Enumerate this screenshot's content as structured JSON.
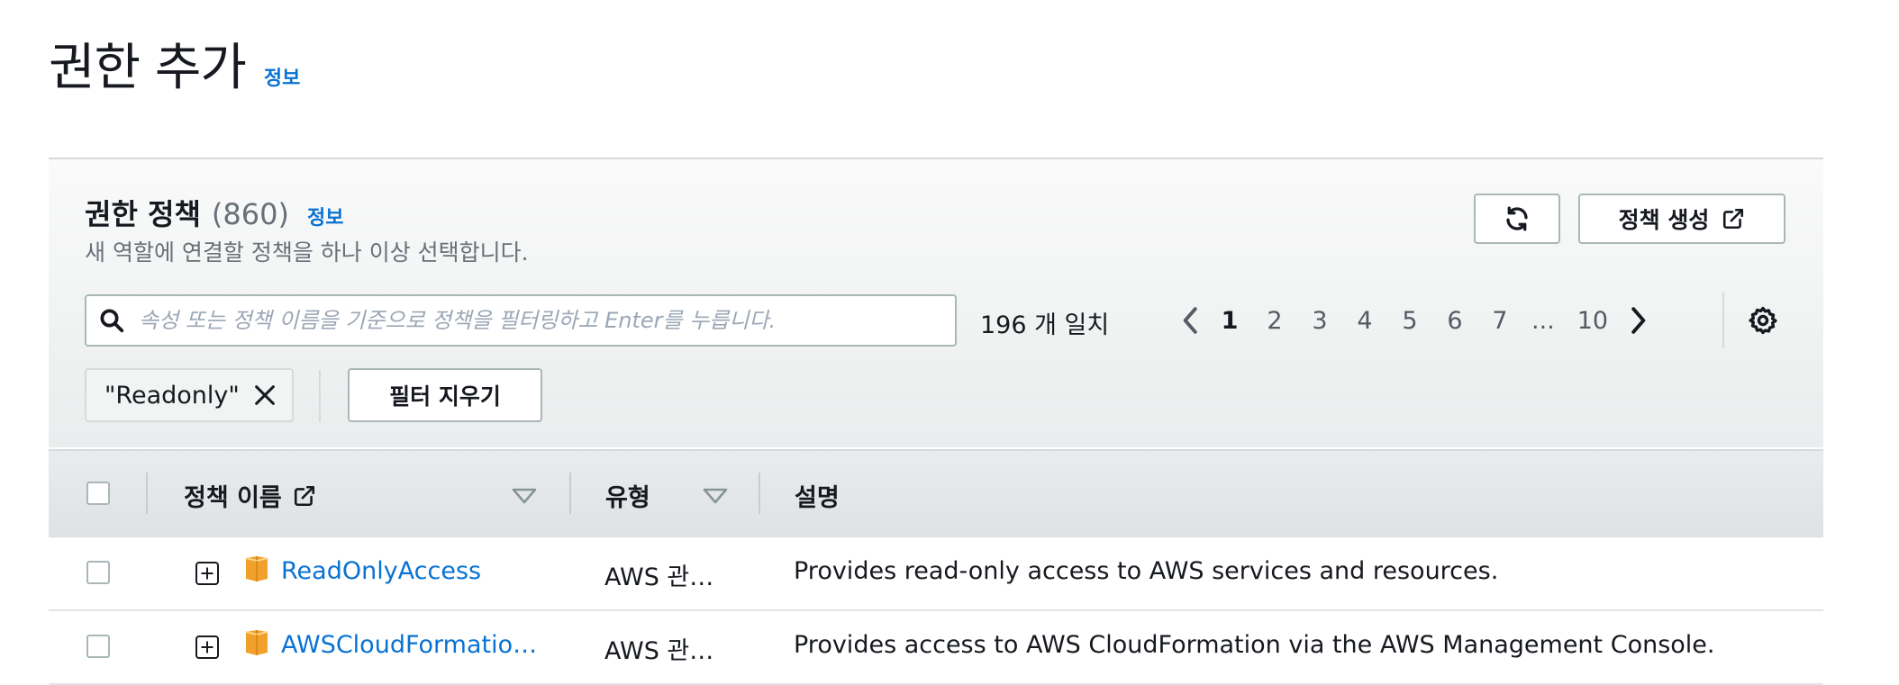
{
  "page": {
    "title": "권한 추가",
    "info_label": "정보"
  },
  "policies_panel": {
    "title": "권한 정책",
    "count": "(860)",
    "info_label": "정보",
    "description": "새 역할에 연결할 정책을 하나 이상 선택합니다.",
    "refresh_icon": "refresh-icon",
    "create_policy_label": "정책 생성",
    "create_policy_icon": "external-link-icon"
  },
  "filter": {
    "placeholder": "속성 또는 정책 이름을 기준으로 정책을 필터링하고 Enter를 누릅니다.",
    "value": "",
    "match_count": "196 개 일치",
    "token_label": "\"Readonly\"",
    "clear_label": "필터 지우기"
  },
  "pagination": {
    "prev_icon": "chevron-left-icon",
    "next_icon": "chevron-right-icon",
    "pages": [
      "1",
      "2",
      "3",
      "4",
      "5",
      "6",
      "7"
    ],
    "current": "1",
    "ellipsis": "...",
    "last": "10",
    "settings_icon": "gear-icon"
  },
  "table": {
    "columns": {
      "name": "정책 이름",
      "type": "유형",
      "description": "설명"
    },
    "rows": [
      {
        "name": "ReadOnlyAccess",
        "type": "AWS 관…",
        "description": "Provides read-only access to AWS services and resources."
      },
      {
        "name": "AWSCloudFormatio…",
        "type": "AWS 관…",
        "description": "Provides access to AWS CloudFormation via the AWS Management Console."
      }
    ]
  },
  "colors": {
    "link": "#0972d3",
    "text": "#16191f",
    "muted": "#687078",
    "border": "#aab7b8",
    "package": "#f0a02b"
  }
}
